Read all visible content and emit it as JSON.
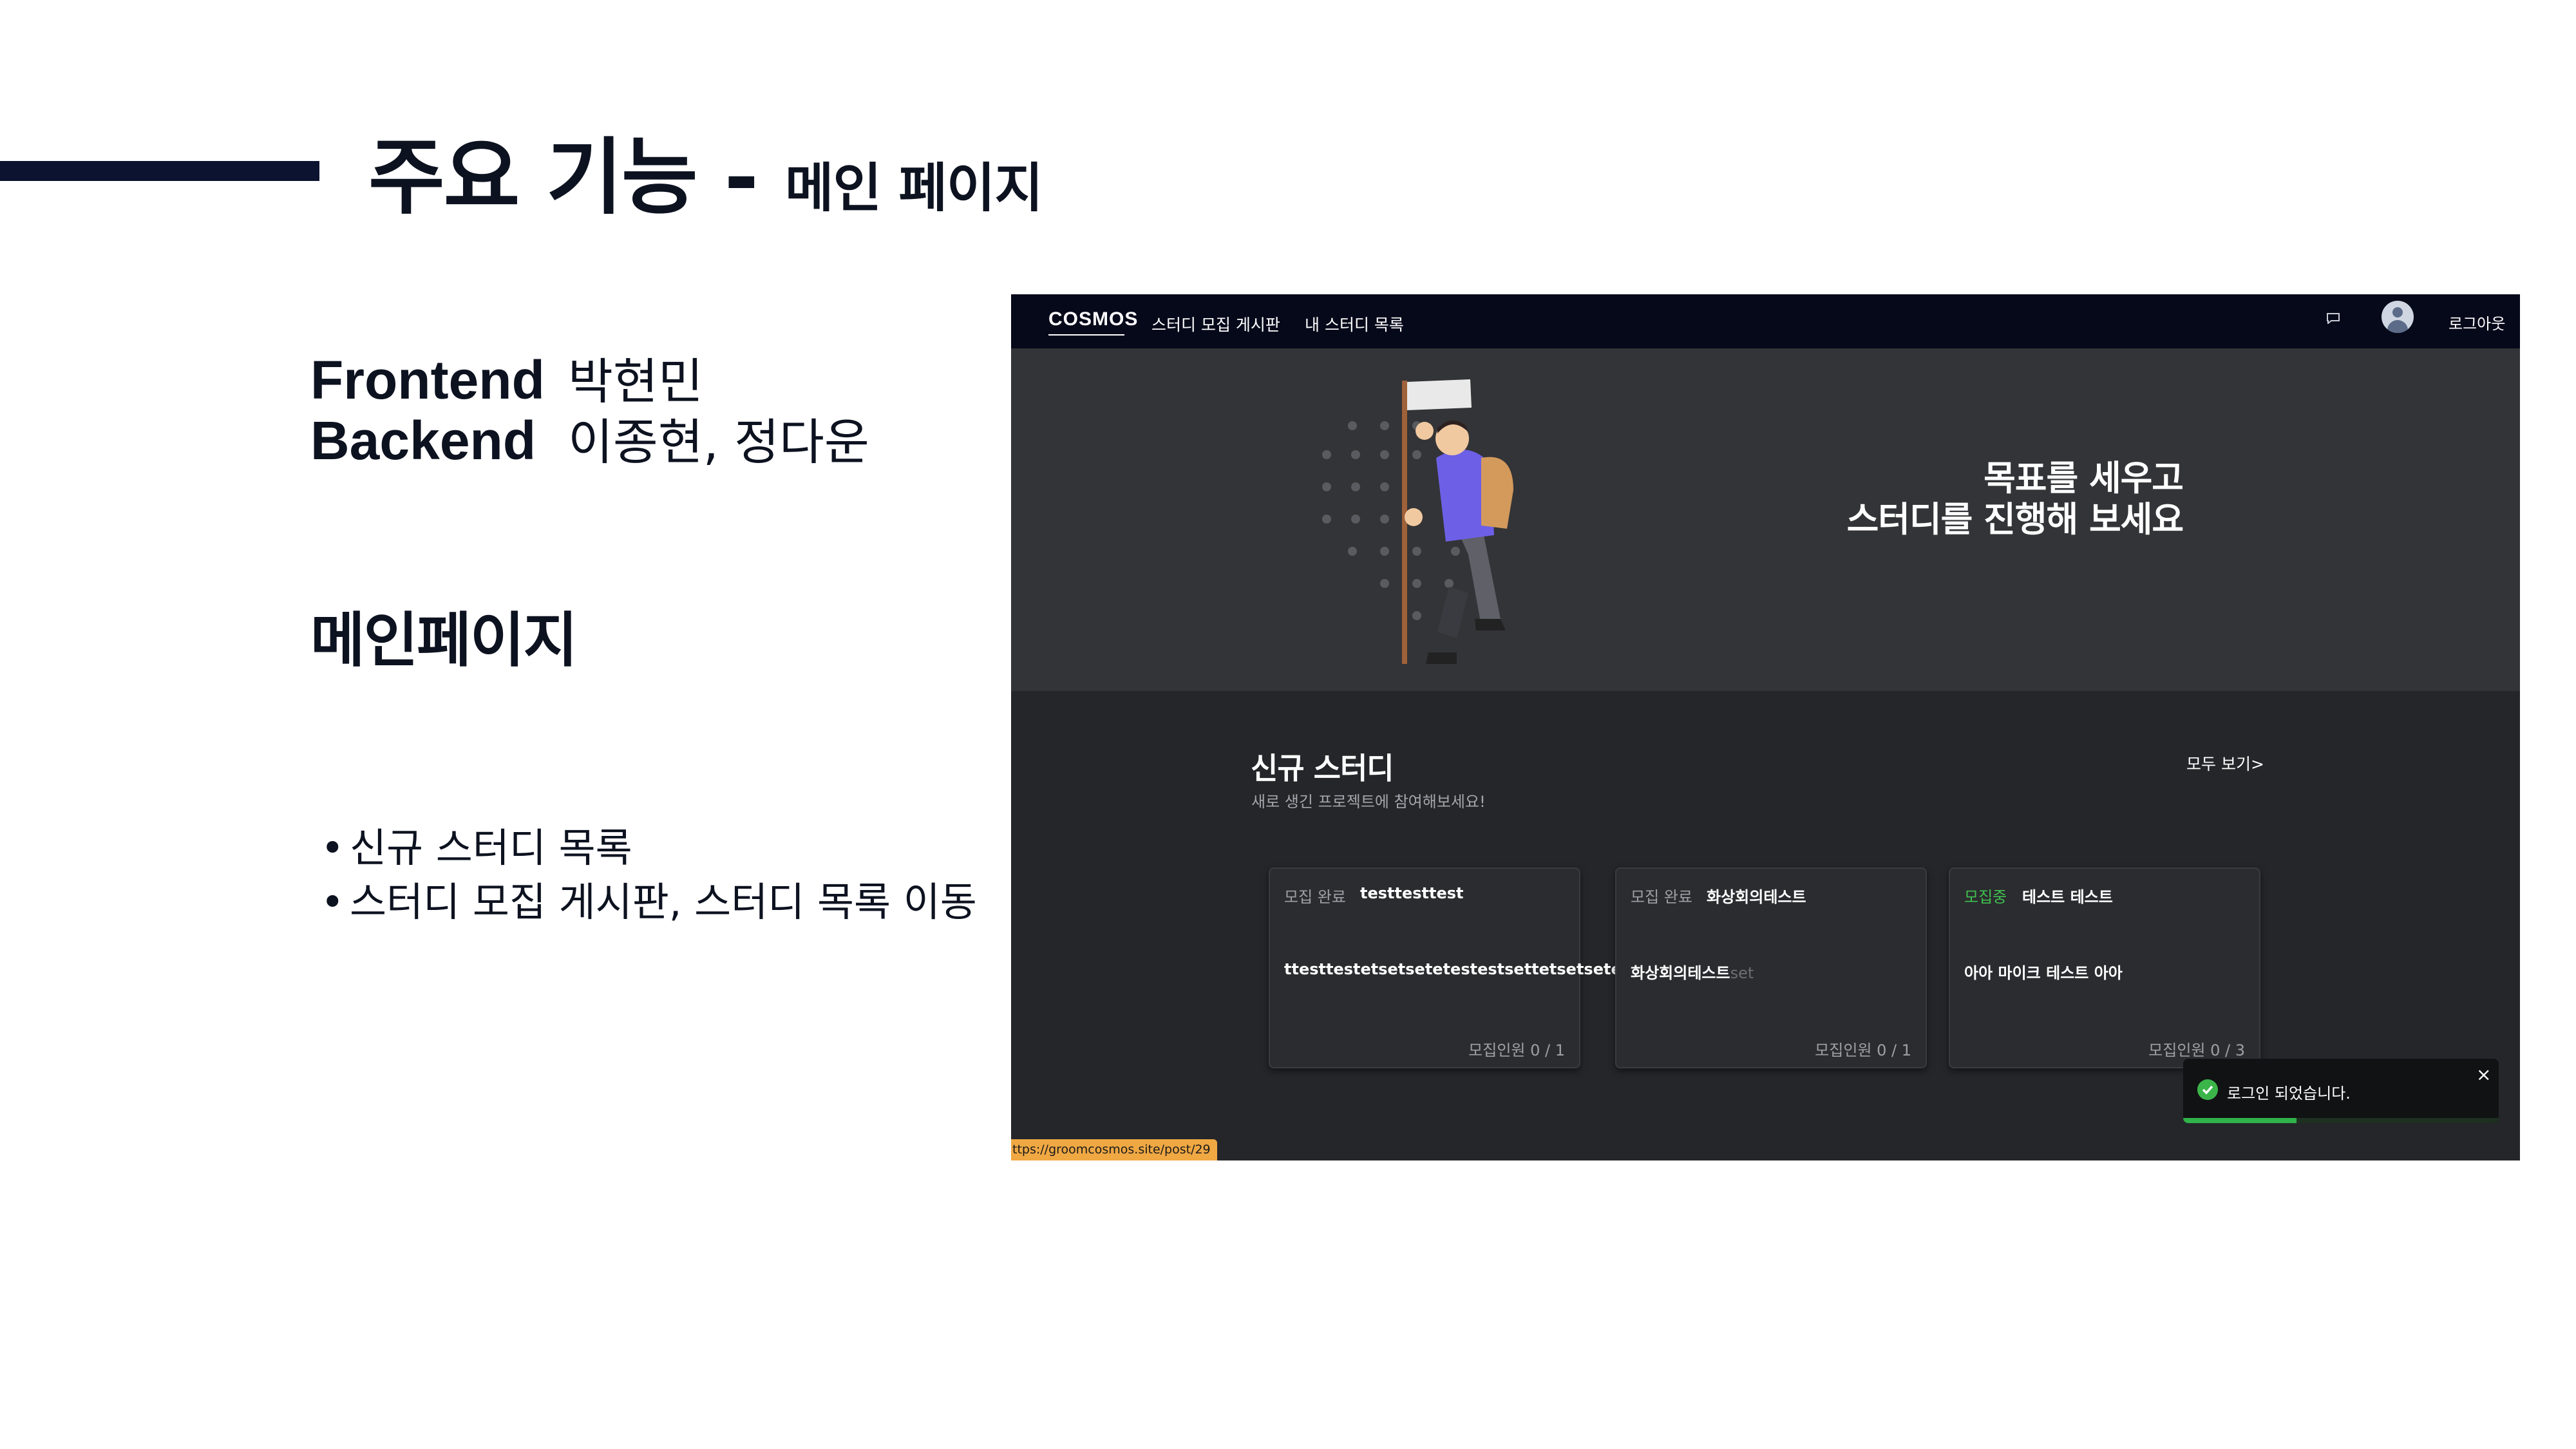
{
  "slide": {
    "title": "주요 기능 -",
    "title_sub": "메인 페이지",
    "roles": [
      {
        "role": "Frontend",
        "names": "박현민"
      },
      {
        "role": "Backend",
        "names": "이종현, 정다운"
      }
    ],
    "section_heading": "메인페이지",
    "bullets": [
      "신규 스터디 목록",
      "스터디 모집 게시판, 스터디 목록 이동"
    ]
  },
  "app": {
    "logo": "COSMOS",
    "nav": [
      "스터디 모집 게시판",
      "내 스터디 목록"
    ],
    "logout": "로그아웃",
    "hero_title_line1": "목표를 세우고",
    "hero_title_line2": "스터디를 진행해 보세요",
    "section": {
      "title": "신규 스터디",
      "subtitle": "새로 생긴 프로젝트에 참여해보세요!",
      "see_all": "모두 보기>"
    },
    "cards": [
      {
        "status": "모집 완료",
        "status_color": "#9da0a7",
        "title": "testtesttest",
        "body": "ttesttestetsetsetetestestsettetsetsetestsetset",
        "count": "모집인원 0 / 1"
      },
      {
        "status": "모집 완료",
        "status_color": "#9da0a7",
        "title": "화상회의테스트",
        "body": "화상회의테스트",
        "body_fade": "set",
        "count": "모집인원 0 / 1"
      },
      {
        "status": "모집중",
        "status_color": "#3fbf4f",
        "title": "테스트 테스트",
        "body": "아아 마이크 테스트 아아",
        "count": "모집인원 0 / 3"
      }
    ],
    "toast": {
      "message": "로그인 되었습니다.",
      "close": "×",
      "progress": 0.36
    },
    "status_url": "ttps://groomcosmos.site/post/29"
  },
  "colors": {
    "navy": "#0c1330",
    "success": "#2fb34a",
    "url_badge": "#f0a843"
  }
}
